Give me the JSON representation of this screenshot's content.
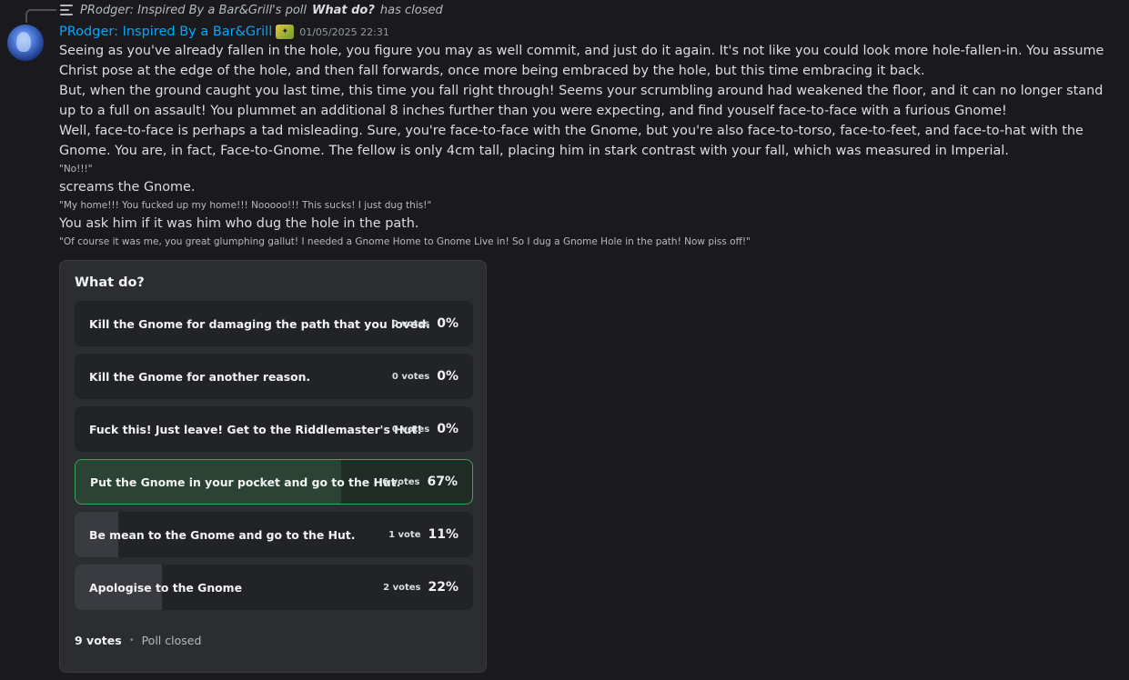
{
  "reply": {
    "icon": "poll-icon",
    "prefix": "PRodger: Inspired By a Bar&Grill's poll",
    "poll_name": "What do?",
    "suffix": "has closed"
  },
  "message": {
    "username": "PRodger: Inspired By a Bar&Grill",
    "role_icon": "sparkle-badge-icon",
    "timestamp": "01/05/2025 22:31",
    "lines": {
      "l1": "Seeing as you've already fallen in the hole, you figure you may as well commit, and just do it again. It's not like you could look more hole-fallen-in. You assume Christ pose at the edge of the hole, and then fall forwards, once more being embraced by the hole, but this time embracing it back.",
      "l2": "But, when the ground caught you last time, this time you fall right through! Seems your scrumbling around had weakened the floor, and it can no longer stand up to a full on assault! You plummet an additional 8 inches further than you were expecting, and find youself face-to-face with a furious Gnome!",
      "l3": "Well, face-to-face is perhaps a tad misleading. Sure, you're face-to-face with the Gnome, but you're also face-to-torso, face-to-feet, and face-to-hat with the Gnome. You are, in fact, Face-to-Gnome. The fellow is only 4cm tall, placing him in stark contrast with your fall, which was measured in Imperial.",
      "l4": "\"No!!!\"",
      "l5": "screams the Gnome.",
      "l6": "\"My home!!! You fucked up my home!!! Nooooo!!! This sucks! I just dug this!\"",
      "l7": "You ask him if it was him who dug the hole in the path.",
      "l8": "\"Of course it was me, you great glumphing gallut! I needed a Gnome Home to Gnome Live in! So I dug a Gnome Hole in the path! Now piss off!\""
    }
  },
  "poll": {
    "question": "What do?",
    "answers": [
      {
        "label": "Kill the Gnome for damaging the path that you loved.",
        "votes": "0 votes",
        "percent": "0%",
        "fraction": 0
      },
      {
        "label": "Kill the Gnome for another reason.",
        "votes": "0 votes",
        "percent": "0%",
        "fraction": 0
      },
      {
        "label": "Fuck this! Just leave! Get to the Riddlemaster's Hut!",
        "votes": "0 votes",
        "percent": "0%",
        "fraction": 0
      },
      {
        "label": "Put the Gnome in your pocket and go to the Hut.",
        "votes": "6 votes",
        "percent": "67%",
        "fraction": 0.67,
        "winner": true
      },
      {
        "label": "Be mean to the Gnome and go to the Hut.",
        "votes": "1 vote",
        "percent": "11%",
        "fraction": 0.11
      },
      {
        "label": "Apologise to the Gnome",
        "votes": "2 votes",
        "percent": "22%",
        "fraction": 0.22
      }
    ],
    "total_votes": "9 votes",
    "separator": "•",
    "status": "Poll closed"
  },
  "colors": {
    "background": "#1a1a1e",
    "username": "#00a8fc",
    "winner_border": "#3ba55c",
    "poll_bg": "#2b2d31"
  }
}
